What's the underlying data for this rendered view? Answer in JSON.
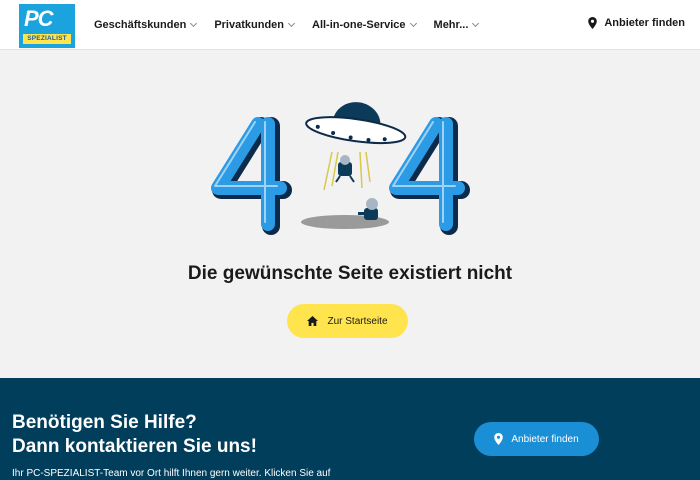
{
  "header": {
    "logo": {
      "main": "PC",
      "sub": "SPEZIALIST"
    },
    "nav": [
      {
        "label": "Geschäftskunden"
      },
      {
        "label": "Privatkunden"
      },
      {
        "label": "All-in-one-Service"
      },
      {
        "label": "Mehr..."
      }
    ],
    "find_label": "Anbieter finden",
    "find_icon": "location-pin-icon"
  },
  "error": {
    "code_digits": [
      "4",
      "4"
    ],
    "title": "Die gewünschte Seite existiert nicht",
    "home_label": "Zur Startseite",
    "home_icon": "home-icon"
  },
  "footer": {
    "line1": "Benötigen Sie Hilfe?",
    "line2": "Dann kontaktieren Sie uns!",
    "text": "Ihr PC-SPEZIALIST-Team vor Ort hilft Ihnen gern weiter. Klicken Sie auf",
    "button_label": "Anbieter finden",
    "button_icon": "location-pin-icon"
  },
  "colors": {
    "brand_blue": "#1aa3dc",
    "brand_yellow": "#ffe44d",
    "footer_bg": "#003e5c",
    "digit_blue": "#2b9be6",
    "footer_button": "#1a8fd6"
  }
}
